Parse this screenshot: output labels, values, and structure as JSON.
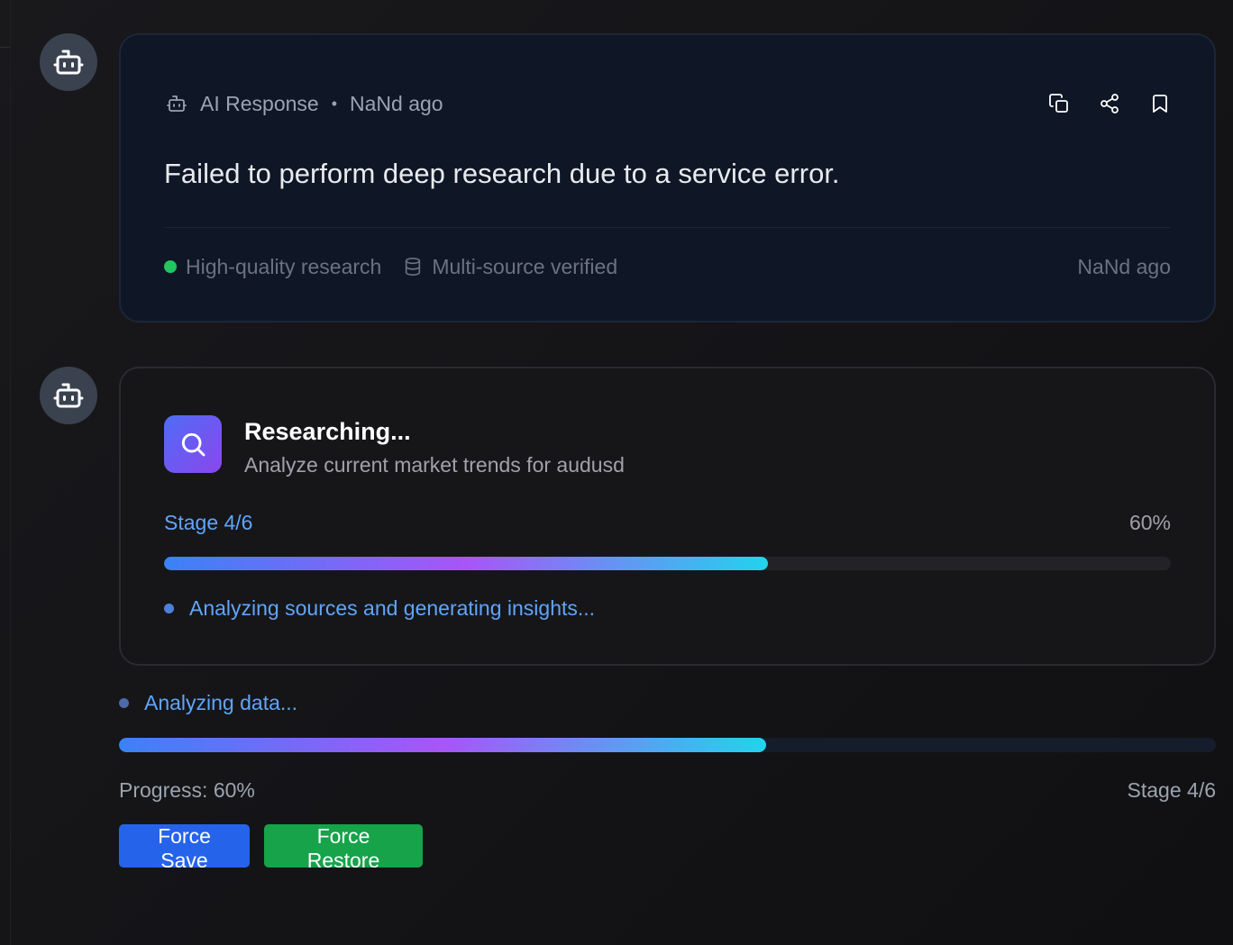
{
  "response": {
    "label": "AI Response",
    "separator": "•",
    "time": "NaNd ago",
    "message": "Failed to perform deep research due to a service error.",
    "footer": {
      "quality": "High-quality research",
      "verified": "Multi-source verified",
      "time": "NaNd ago"
    },
    "actions": [
      "copy-icon",
      "share-icon",
      "bookmark-icon"
    ]
  },
  "research": {
    "title": "Researching...",
    "query": "Analyze current market trends for audusd",
    "stage": "Stage 4/6",
    "percent_label": "60%",
    "progress": 0.6,
    "insight": "Analyzing sources and generating insights..."
  },
  "status": {
    "text": "Analyzing data...",
    "progress": 0.59,
    "progress_label": "Progress: 60%",
    "stage": "Stage 4/6"
  },
  "buttons": {
    "save": "Force Save",
    "restore": "Force Restore"
  },
  "colors": {
    "save": "#2563eb",
    "restore": "#16a34a",
    "accent": "#60a5fa",
    "quality_dot": "#22c55e"
  }
}
